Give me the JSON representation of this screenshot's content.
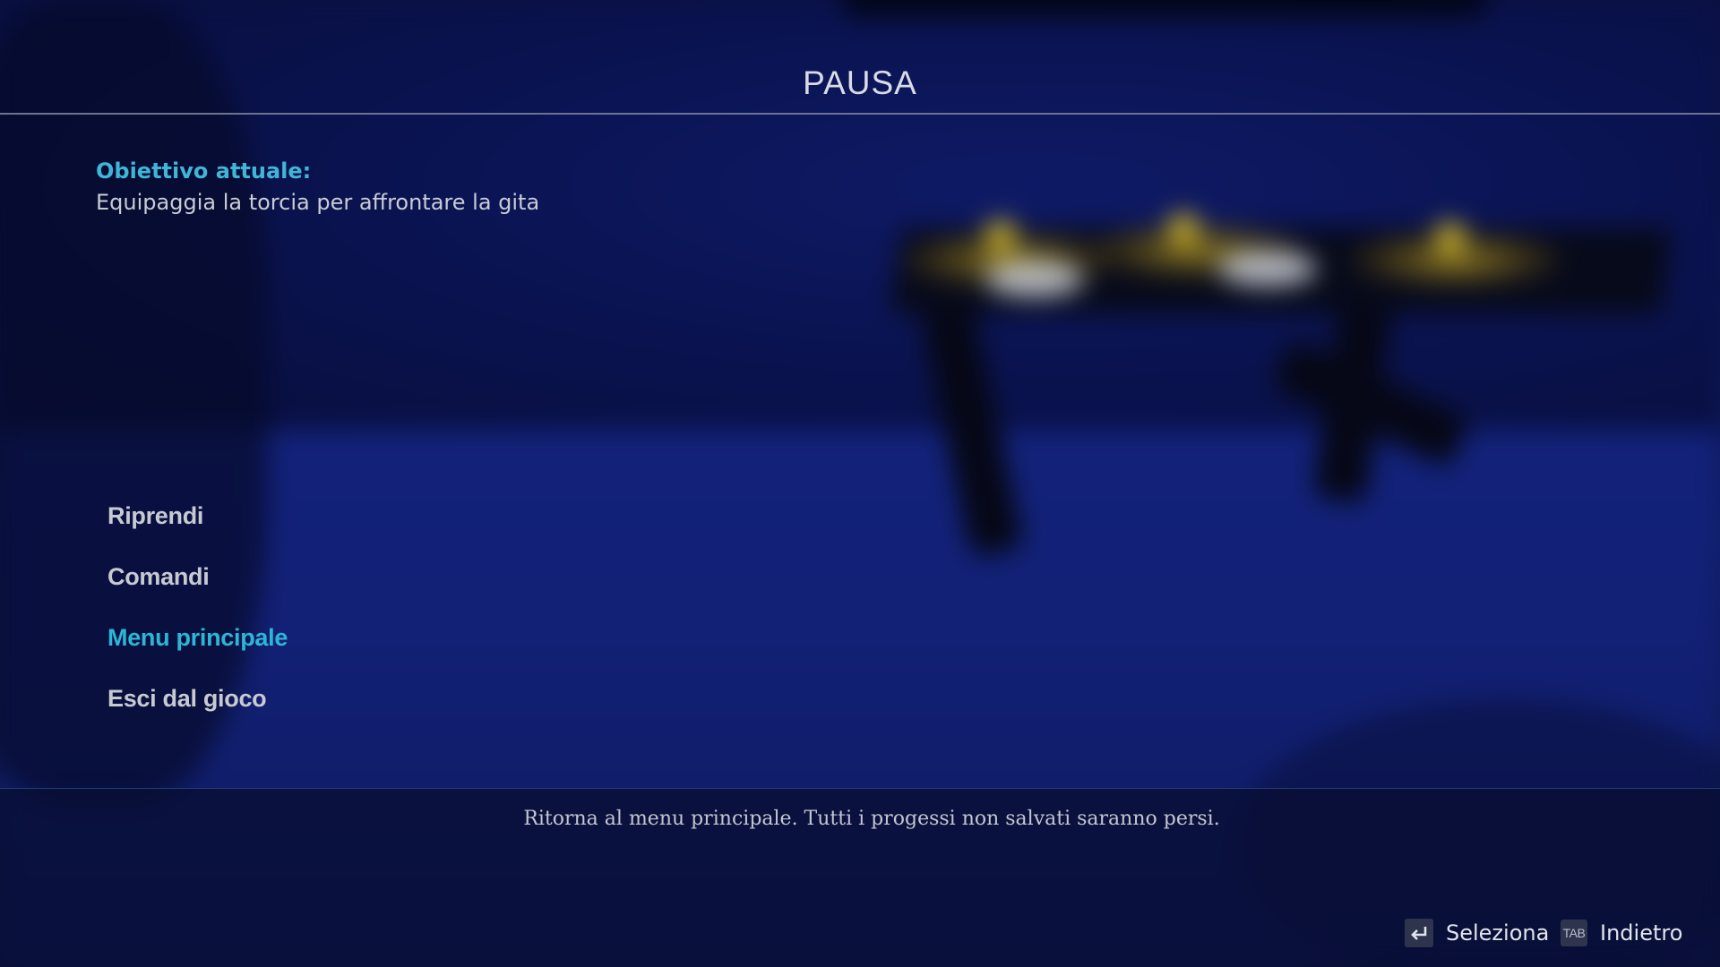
{
  "header": {
    "title": "PAUSA"
  },
  "objective": {
    "label": "Obiettivo attuale:",
    "text": "Equipaggia la torcia per affrontare la gita"
  },
  "menu": {
    "items": [
      {
        "label": "Riprendi",
        "active": false
      },
      {
        "label": "Comandi",
        "active": false
      },
      {
        "label": "Menu principale",
        "active": true
      },
      {
        "label": "Esci dal gioco",
        "active": false
      }
    ]
  },
  "description": {
    "text": "Ritorna al menu principale. Tutti i progessi non salvati saranno persi."
  },
  "hints": {
    "select": {
      "key_icon": "enter-key-icon",
      "label": "Seleziona"
    },
    "back": {
      "key": "TAB",
      "label": "Indietro"
    }
  },
  "colors": {
    "accent": "#2cb6d6",
    "objective_label": "#3fb6d8",
    "menu_text": "#c8cad2",
    "background": "#0f1d62"
  }
}
